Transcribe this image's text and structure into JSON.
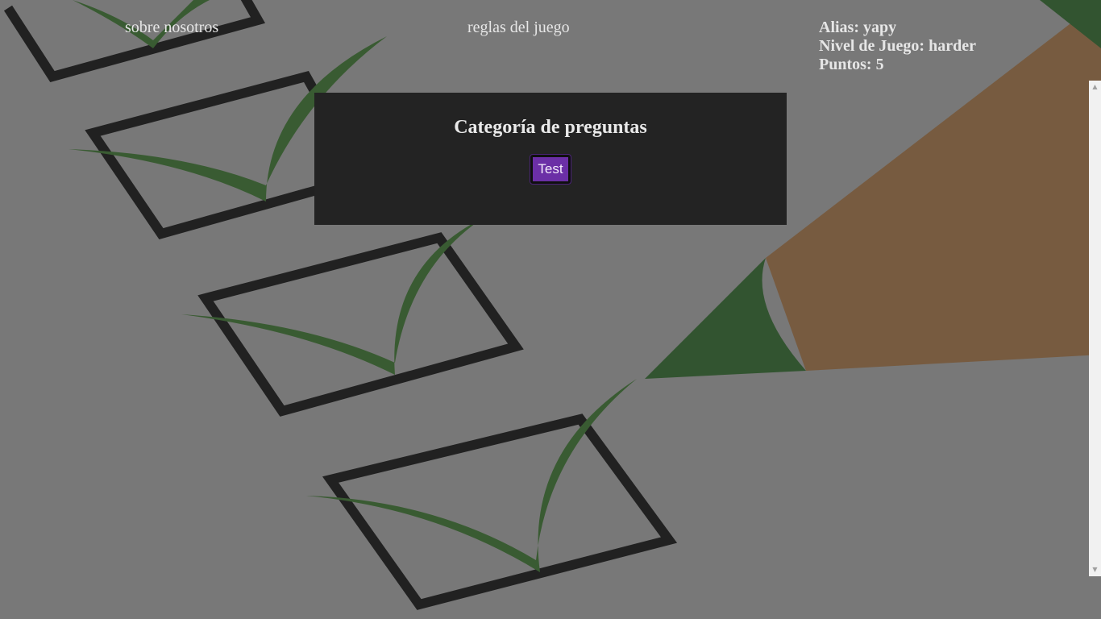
{
  "nav": {
    "about_label": "sobre nosotros",
    "rules_label": "reglas del juego"
  },
  "player": {
    "alias": "Alias: yapy",
    "level": "Nivel de Juego: harder",
    "points": "Puntos: 5"
  },
  "modal": {
    "title": "Categoría de preguntas",
    "categories": [
      "Test"
    ],
    "button_color": "#6b2fa6"
  },
  "scrollbar": {
    "up_icon": "triangle-up-icon",
    "down_icon": "triangle-down-icon"
  }
}
